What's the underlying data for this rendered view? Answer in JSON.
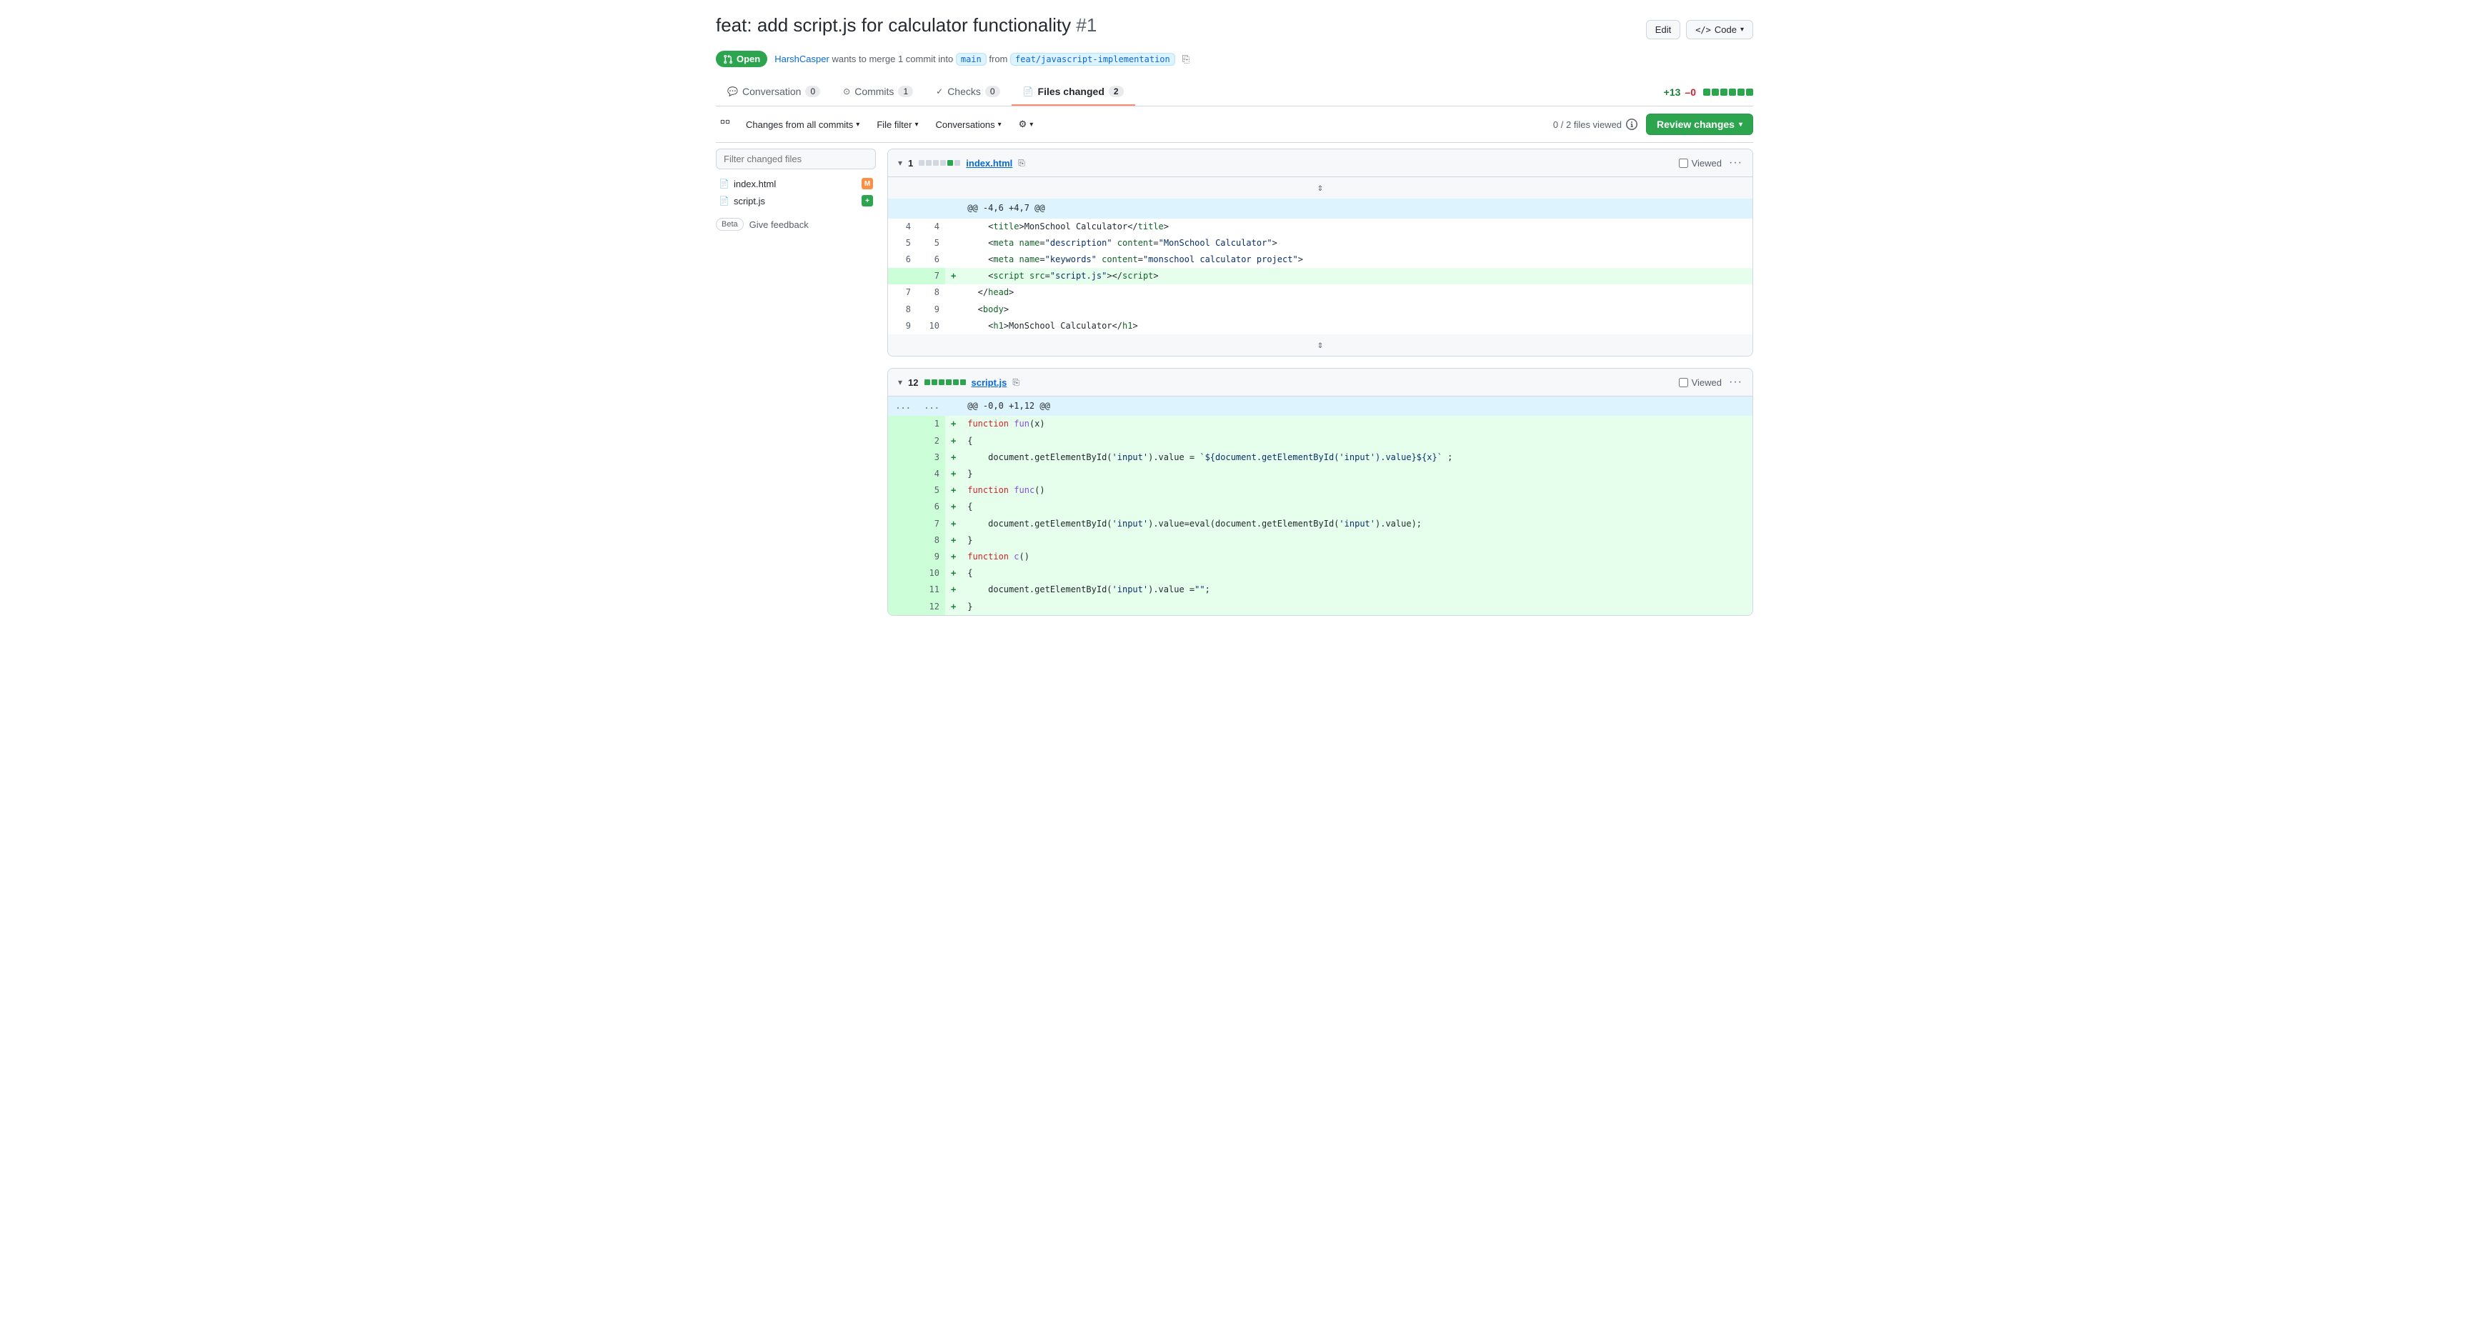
{
  "page": {
    "title": "feat: add script.js for calculator functionality",
    "pr_number": "#1",
    "status": "Open",
    "author": "HarshCasper",
    "merge_target": "main",
    "source_branch": "feat/javascript-implementation",
    "edit_label": "Edit",
    "code_label": "Code"
  },
  "tabs": [
    {
      "id": "conversation",
      "label": "Conversation",
      "count": "0"
    },
    {
      "id": "commits",
      "label": "Commits",
      "count": "1"
    },
    {
      "id": "checks",
      "label": "Checks",
      "count": "0"
    },
    {
      "id": "files-changed",
      "label": "Files changed",
      "count": "2",
      "active": true
    }
  ],
  "toolbar": {
    "changes_label": "Changes from all commits",
    "file_filter_label": "File filter",
    "conversations_label": "Conversations",
    "settings_icon": "⚙",
    "files_viewed": "0 / 2 files viewed",
    "review_label": "Review changes"
  },
  "diff_stats": {
    "additions": "+13",
    "deletions": "–0",
    "blocks": [
      {
        "type": "green"
      },
      {
        "type": "green"
      },
      {
        "type": "green"
      },
      {
        "type": "green"
      },
      {
        "type": "green"
      },
      {
        "type": "green"
      }
    ]
  },
  "sidebar": {
    "filter_placeholder": "Filter changed files",
    "files": [
      {
        "name": "index.html",
        "badge_type": "modified"
      },
      {
        "name": "script.js",
        "badge_type": "added"
      }
    ],
    "beta_label": "Beta",
    "feedback_label": "Give feedback"
  },
  "diff_files": [
    {
      "id": "index-html",
      "collapsed": false,
      "change_count": "1",
      "diff_blocks": [
        {
          "type": "gray"
        },
        {
          "type": "gray"
        },
        {
          "type": "gray"
        },
        {
          "type": "gray"
        },
        {
          "type": "green"
        },
        {
          "type": "gray"
        }
      ],
      "filename": "index.html",
      "viewed_label": "Viewed",
      "hunk_header": "@@ -4,6 +4,7 @@",
      "lines": [
        {
          "type": "context",
          "left_num": "4",
          "right_num": "4",
          "sign": " ",
          "code": "    &lt;title&gt;MonSchool Calculator&lt;/title&gt;"
        },
        {
          "type": "context",
          "left_num": "5",
          "right_num": "5",
          "sign": " ",
          "code": "    &lt;meta name=\"description\" content=\"MonSchool Calculator\"&gt;"
        },
        {
          "type": "context",
          "left_num": "6",
          "right_num": "6",
          "sign": " ",
          "code": "    &lt;meta name=\"keywords\" content=\"monschool calculator project\"&gt;"
        },
        {
          "type": "add",
          "left_num": "",
          "right_num": "7",
          "sign": "+",
          "code": "    &lt;script src=\"script.js\"&gt;&lt;/script&gt;"
        },
        {
          "type": "context",
          "left_num": "7",
          "right_num": "8",
          "sign": " ",
          "code": "  &lt;/head&gt;"
        },
        {
          "type": "context",
          "left_num": "8",
          "right_num": "9",
          "sign": " ",
          "code": "  &lt;body&gt;"
        },
        {
          "type": "context",
          "left_num": "9",
          "right_num": "10",
          "sign": " ",
          "code": "    &lt;h1&gt;MonSchool Calculator&lt;/h1&gt;"
        }
      ],
      "has_expand_bottom": true
    },
    {
      "id": "script-js",
      "collapsed": false,
      "change_count": "12",
      "diff_blocks": [
        {
          "type": "green"
        },
        {
          "type": "green"
        },
        {
          "type": "green"
        },
        {
          "type": "green"
        },
        {
          "type": "green"
        },
        {
          "type": "green"
        }
      ],
      "filename": "script.js",
      "viewed_label": "Viewed",
      "hunk_header": "@@ -0,0 +1,12 @@",
      "hunk_left": "...",
      "hunk_right": "...",
      "lines": [
        {
          "type": "add",
          "left_num": "",
          "right_num": "1",
          "sign": "+",
          "code": "function fun(x)"
        },
        {
          "type": "add",
          "left_num": "",
          "right_num": "2",
          "sign": "+",
          "code": "{"
        },
        {
          "type": "add",
          "left_num": "",
          "right_num": "3",
          "sign": "+",
          "code": "    document.getElementById('input').value = `${document.getElementById('input').value}${x}` ;"
        },
        {
          "type": "add",
          "left_num": "",
          "right_num": "4",
          "sign": "+",
          "code": "}"
        },
        {
          "type": "add",
          "left_num": "",
          "right_num": "5",
          "sign": "+",
          "code": "function func()"
        },
        {
          "type": "add",
          "left_num": "",
          "right_num": "6",
          "sign": "+",
          "code": "{"
        },
        {
          "type": "add",
          "left_num": "",
          "right_num": "7",
          "sign": "+",
          "code": "    document.getElementById('input').value=eval(document.getElementById('input').value);"
        },
        {
          "type": "add",
          "left_num": "",
          "right_num": "8",
          "sign": "+",
          "code": "}"
        },
        {
          "type": "add",
          "left_num": "",
          "right_num": "9",
          "sign": "+",
          "code": "function c()"
        },
        {
          "type": "add",
          "left_num": "",
          "right_num": "10",
          "sign": "+",
          "code": "{"
        },
        {
          "type": "add",
          "left_num": "",
          "right_num": "11",
          "sign": "+",
          "code": "    document.getElementById('input').value =\"\";"
        },
        {
          "type": "add",
          "left_num": "",
          "right_num": "12",
          "sign": "+",
          "code": "}"
        }
      ],
      "has_expand_bottom": false
    }
  ]
}
